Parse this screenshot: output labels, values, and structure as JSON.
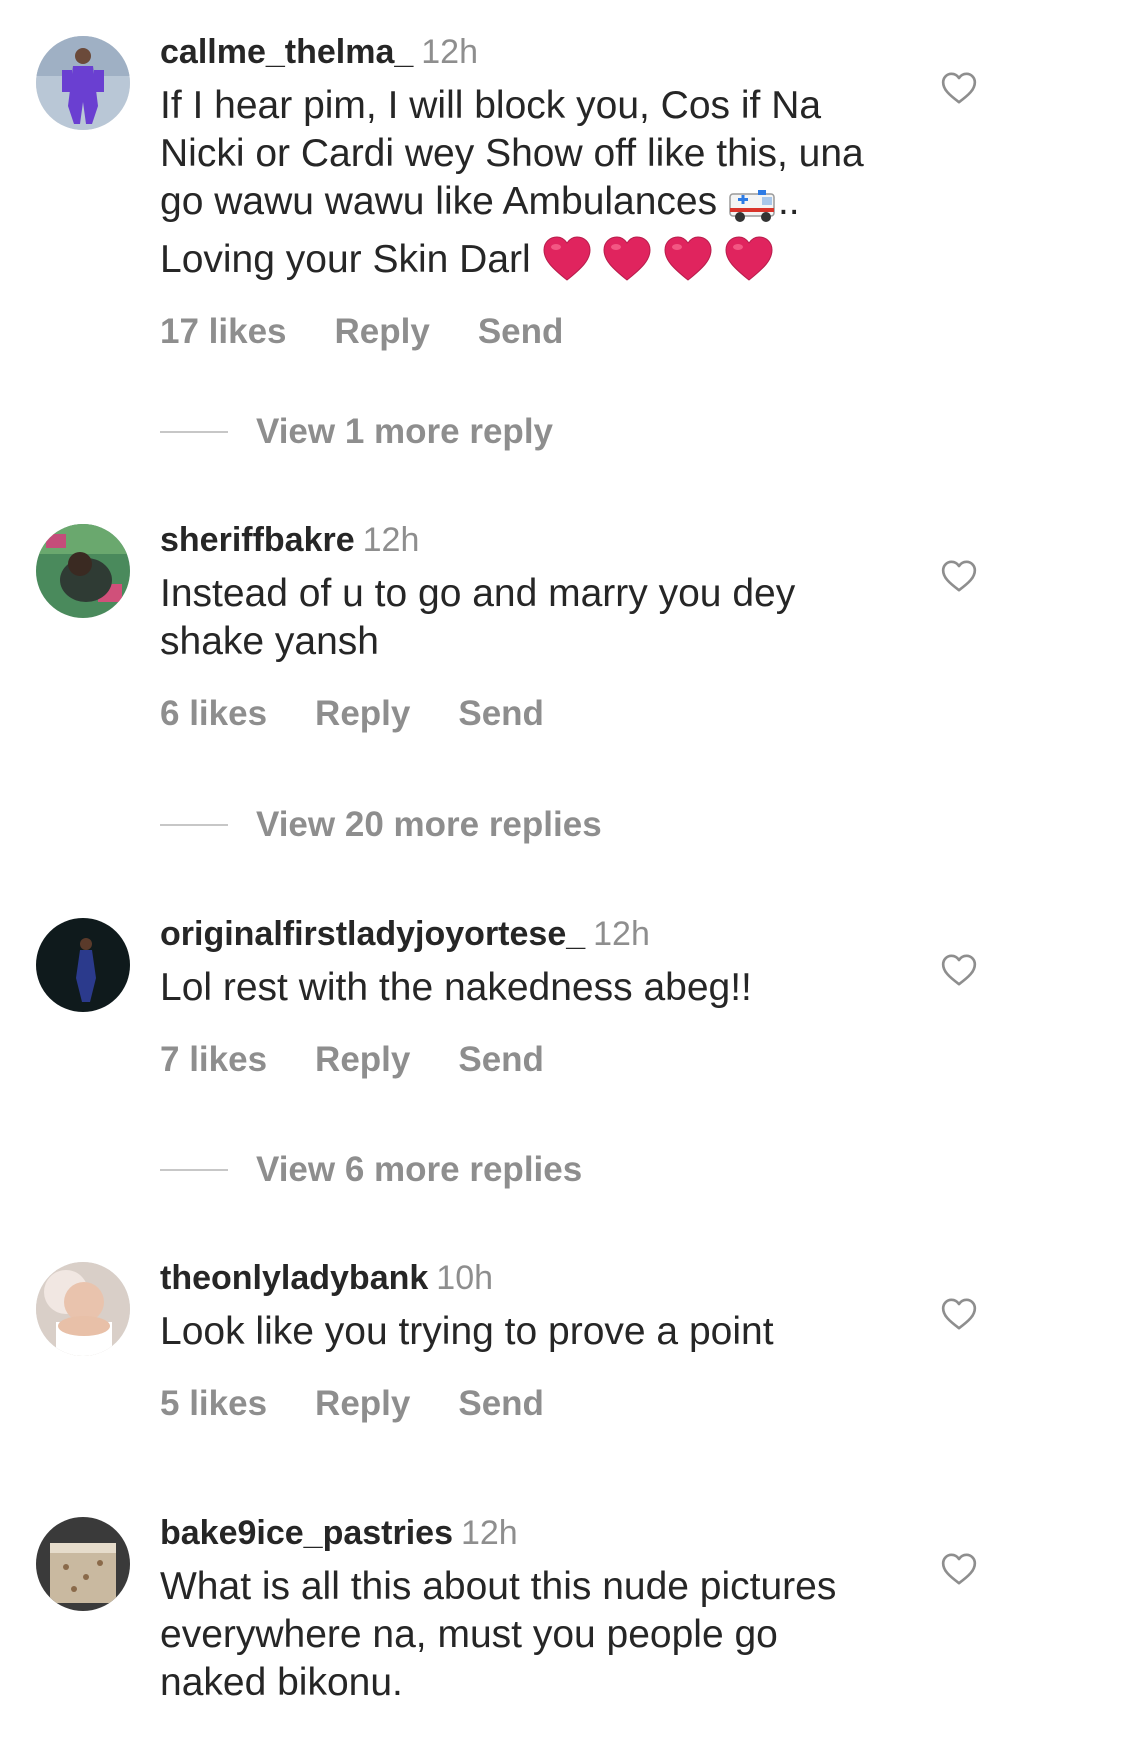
{
  "comments": [
    {
      "username": "callme_thelma_",
      "time": "12h",
      "text_lines": [
        "If I hear pim, I will block you, Cos if Na",
        "Nicki or Cardi wey Show off like this, una",
        "go wawu wawu like Ambulances",
        "Loving your Skin Darl"
      ],
      "line3_suffix": "..",
      "likes": "17 likes",
      "reply": "Reply",
      "send": "Send",
      "view_more": "View 1 more reply"
    },
    {
      "username": "sheriffbakre",
      "time": "12h",
      "text_lines": [
        "Instead of u to go and marry you dey",
        "shake yansh"
      ],
      "likes": "6 likes",
      "reply": "Reply",
      "send": "Send",
      "view_more": "View 20 more replies"
    },
    {
      "username": "originalfirstladyjoyortese_",
      "time": "12h",
      "text_lines": [
        "Lol rest with the nakedness abeg!!"
      ],
      "likes": "7 likes",
      "reply": "Reply",
      "send": "Send",
      "view_more": "View 6 more replies"
    },
    {
      "username": "theonlyladybank",
      "time": "10h",
      "text_lines": [
        "Look like you trying to prove a point"
      ],
      "likes": "5 likes",
      "reply": "Reply",
      "send": "Send"
    },
    {
      "username": "bake9ice_pastries",
      "time": "12h",
      "text_lines": [
        "What is all this about this nude pictures",
        "everywhere na, must you people go",
        "naked bikonu."
      ]
    }
  ],
  "icons": {
    "like": "heart-outline-icon",
    "ambulance": "ambulance-emoji",
    "red_heart": "red-heart-emoji"
  },
  "colors": {
    "text": "#262626",
    "secondary": "#8e8e8e",
    "heart": "#e0245e"
  }
}
